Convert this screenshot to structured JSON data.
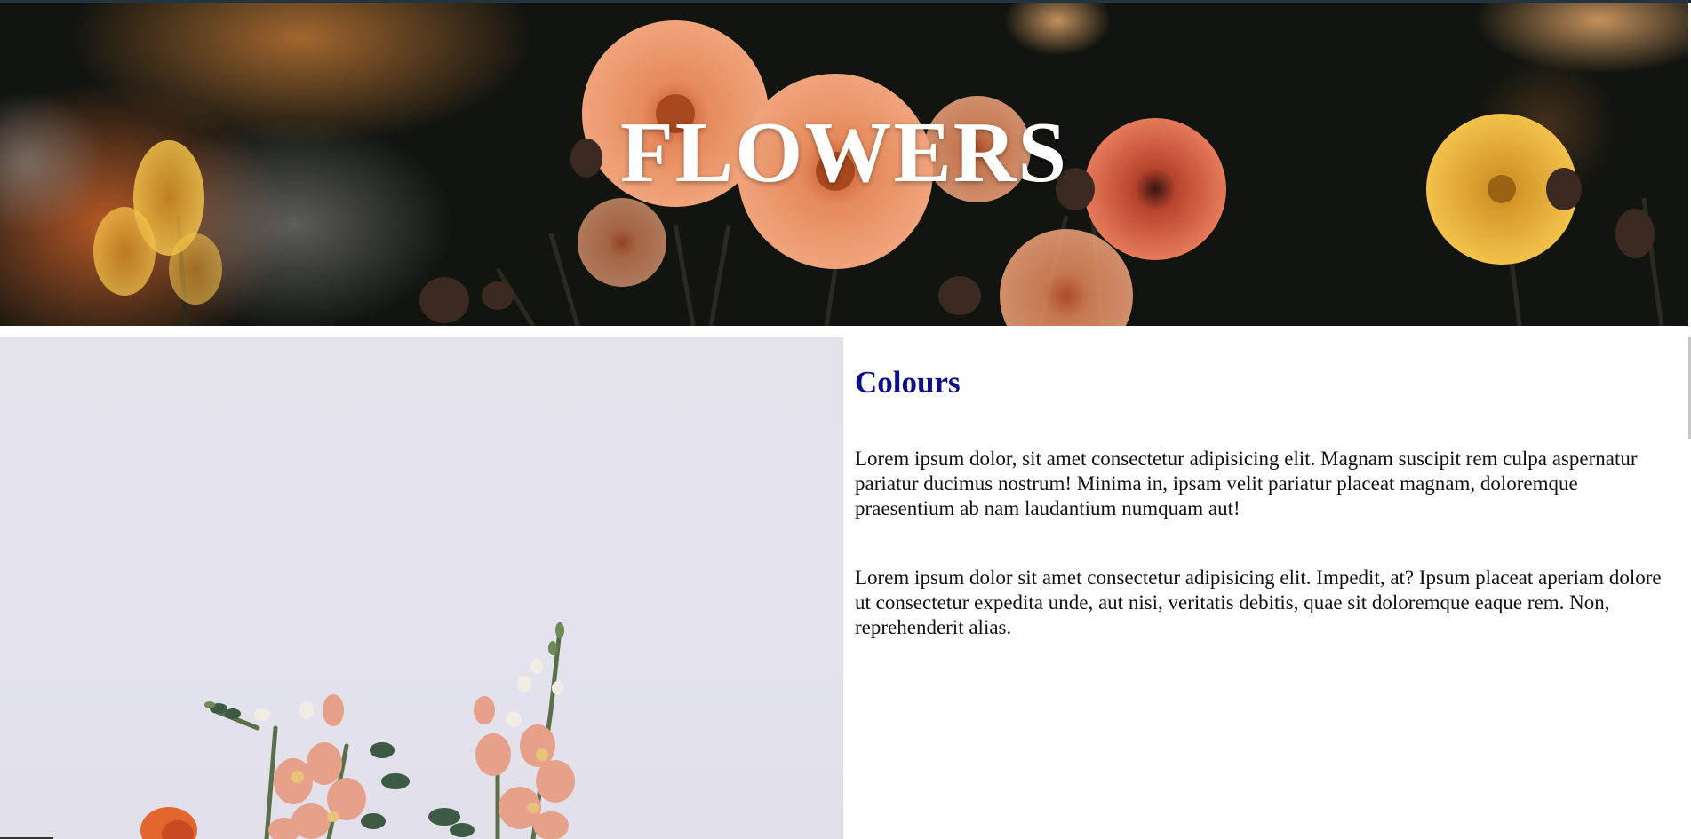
{
  "hero": {
    "title": "FLOWERS",
    "image": "dahlia-flower-banner-photo"
  },
  "feature_image": "snapdragon-bouquet-photo",
  "section": {
    "heading": "Colours",
    "paragraphs": [
      "Lorem ipsum dolor, sit amet consectetur adipisicing elit. Magnam suscipit rem culpa aspernatur pariatur ducimus nostrum! Minima in, ipsam velit pariatur placeat magnam, doloremque praesentium ab nam laudantium numquam aut!",
      "Lorem ipsum dolor sit amet consectetur adipisicing elit. Impedit, at? Ipsum placeat aperiam dolore ut consectetur expedita unde, aut nisi, veritatis debitis, quae sit doloremque eaque rem. Non, reprehenderit alias."
    ]
  },
  "colors": {
    "heading": "#0e0e8c",
    "body_text": "#111111",
    "hero_title": "#ffffff",
    "photo_background": "#e4e3ec"
  }
}
